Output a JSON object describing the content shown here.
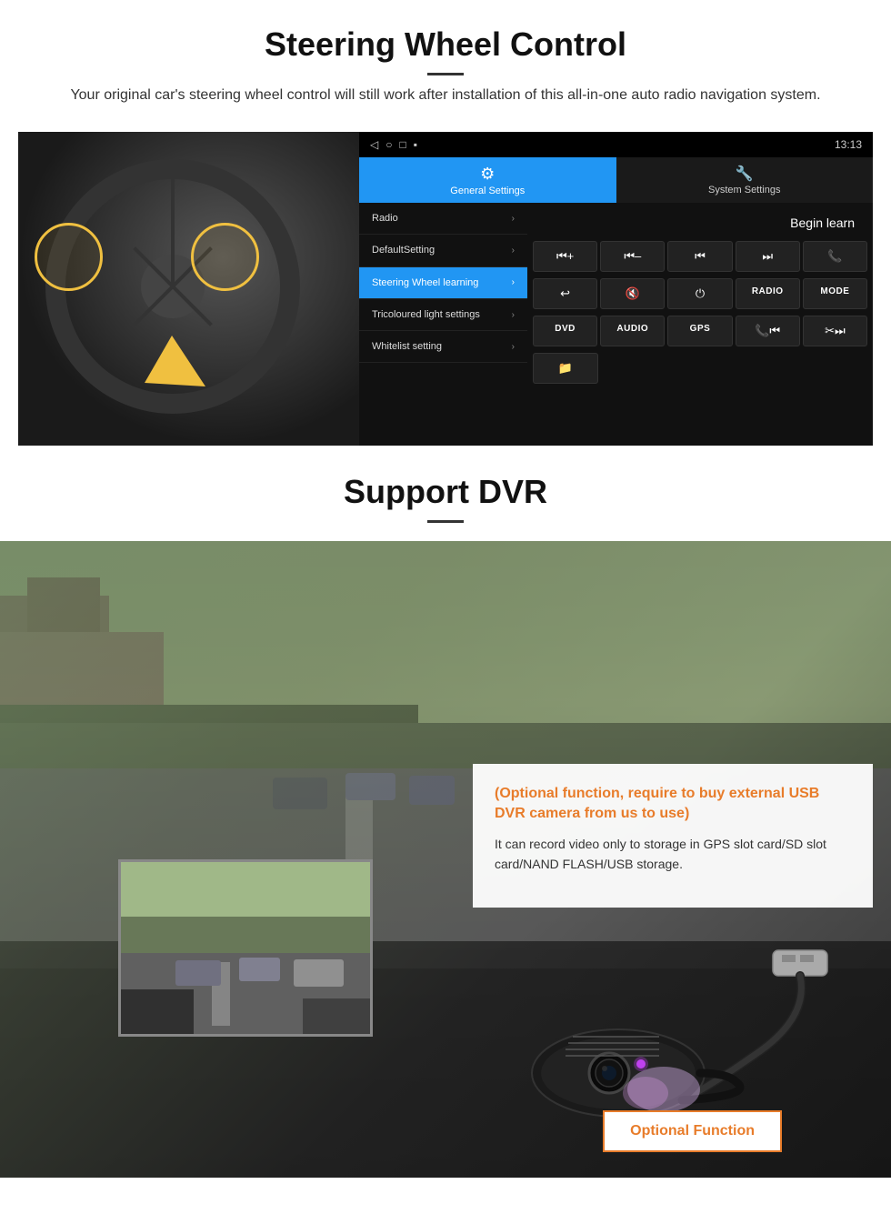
{
  "section1": {
    "title": "Steering Wheel Control",
    "subtitle": "Your original car's steering wheel control will still work after installation of this all-in-one auto radio navigation system.",
    "statusbar": {
      "time": "13:13",
      "icons": [
        "◁",
        "○",
        "□",
        "▪"
      ]
    },
    "tabs": {
      "general": {
        "label": "General Settings",
        "active": true
      },
      "system": {
        "label": "System Settings",
        "active": false
      }
    },
    "menu": [
      {
        "label": "Radio",
        "active": false
      },
      {
        "label": "DefaultSetting",
        "active": false
      },
      {
        "label": "Steering Wheel learning",
        "active": true
      },
      {
        "label": "Tricoloured light settings",
        "active": false
      },
      {
        "label": "Whitelist setting",
        "active": false
      }
    ],
    "begin_learn": "Begin learn",
    "controls_row1": [
      "⏮+",
      "⏮-",
      "⏮",
      "⏭",
      "📞"
    ],
    "controls_row2": [
      "↩",
      "🔇×",
      "⏻",
      "RADIO",
      "MODE"
    ],
    "controls_row3": [
      "DVD",
      "AUDIO",
      "GPS",
      "📞⏮",
      "✂⏭"
    ],
    "controls_row4": [
      "📁"
    ]
  },
  "section2": {
    "title": "Support DVR",
    "divider": true,
    "optional_heading": "(Optional function, require to buy external USB DVR camera from us to use)",
    "description": "It can record video only to storage in GPS slot card/SD slot card/NAND FLASH/USB storage.",
    "optional_btn": "Optional Function"
  }
}
